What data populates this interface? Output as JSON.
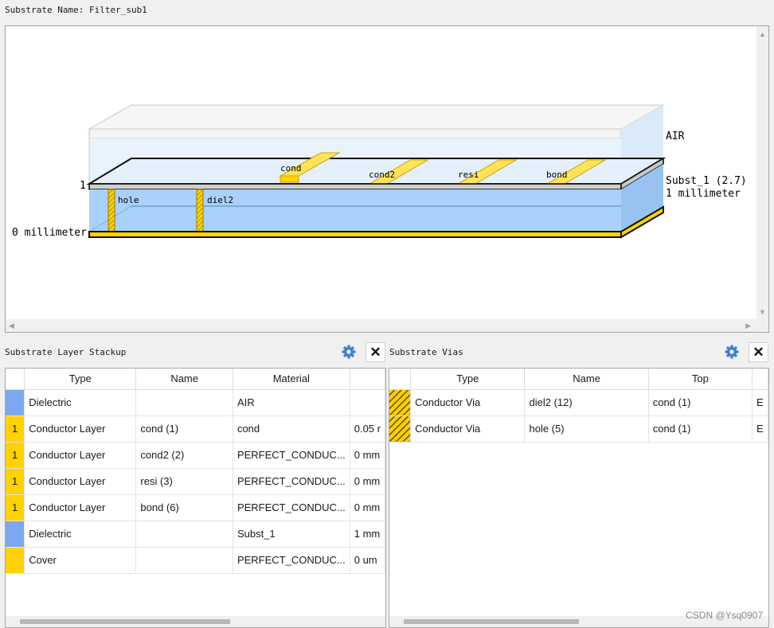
{
  "header": {
    "substrate_name_label": "Substrate Name:  Filter_sub1"
  },
  "viewer": {
    "labels": {
      "air": "AIR",
      "subst": "Subst_1 (2.7)",
      "thickness": "1 millimeter",
      "zero": "0 millimeter",
      "layer_index": "1",
      "cond": "cond",
      "cond2": "cond2",
      "resi": "resi",
      "bond": "bond",
      "hole": "hole",
      "diel2": "diel2"
    },
    "colors": {
      "conductor": "#ffd200",
      "dielectric": "#a9d1fb",
      "air": "#e9f3fd"
    }
  },
  "stackup": {
    "title": "Substrate Layer Stackup",
    "columns": [
      "",
      "Type",
      "Name",
      "Material",
      ""
    ],
    "rows": [
      {
        "marker": "",
        "marker_color": "#7ba8ee",
        "type": "Dielectric",
        "name": "",
        "material": "AIR",
        "extra": ""
      },
      {
        "marker": "1",
        "marker_color": "#ffd200",
        "type": "Conductor Layer",
        "name": "cond (1)",
        "material": "cond",
        "extra": "0.05 r"
      },
      {
        "marker": "1",
        "marker_color": "#ffd200",
        "type": "Conductor Layer",
        "name": "cond2 (2)",
        "material": "PERFECT_CONDUC...",
        "extra": "0 mm"
      },
      {
        "marker": "1",
        "marker_color": "#ffd200",
        "type": "Conductor Layer",
        "name": "resi (3)",
        "material": "PERFECT_CONDUC...",
        "extra": "0 mm"
      },
      {
        "marker": "1",
        "marker_color": "#ffd200",
        "type": "Conductor Layer",
        "name": "bond (6)",
        "material": "PERFECT_CONDUC...",
        "extra": "0 mm"
      },
      {
        "marker": "",
        "marker_color": "#7ba8ee",
        "type": "Dielectric",
        "name": "",
        "material": "Subst_1",
        "extra": "1 mm"
      },
      {
        "marker": "",
        "marker_color": "#ffd200",
        "type": "Cover",
        "name": "",
        "material": "PERFECT_CONDUC...",
        "extra": "0 um"
      }
    ]
  },
  "vias": {
    "title": "Substrate Vias",
    "columns": [
      "",
      "Type",
      "Name",
      "Top",
      ""
    ],
    "rows": [
      {
        "type": "Conductor Via",
        "name": "diel2 (12)",
        "top": "cond (1)",
        "extra": "E"
      },
      {
        "type": "Conductor Via",
        "name": "hole (5)",
        "top": "cond (1)",
        "extra": "E"
      }
    ]
  },
  "watermark": "CSDN @Ysq0907"
}
